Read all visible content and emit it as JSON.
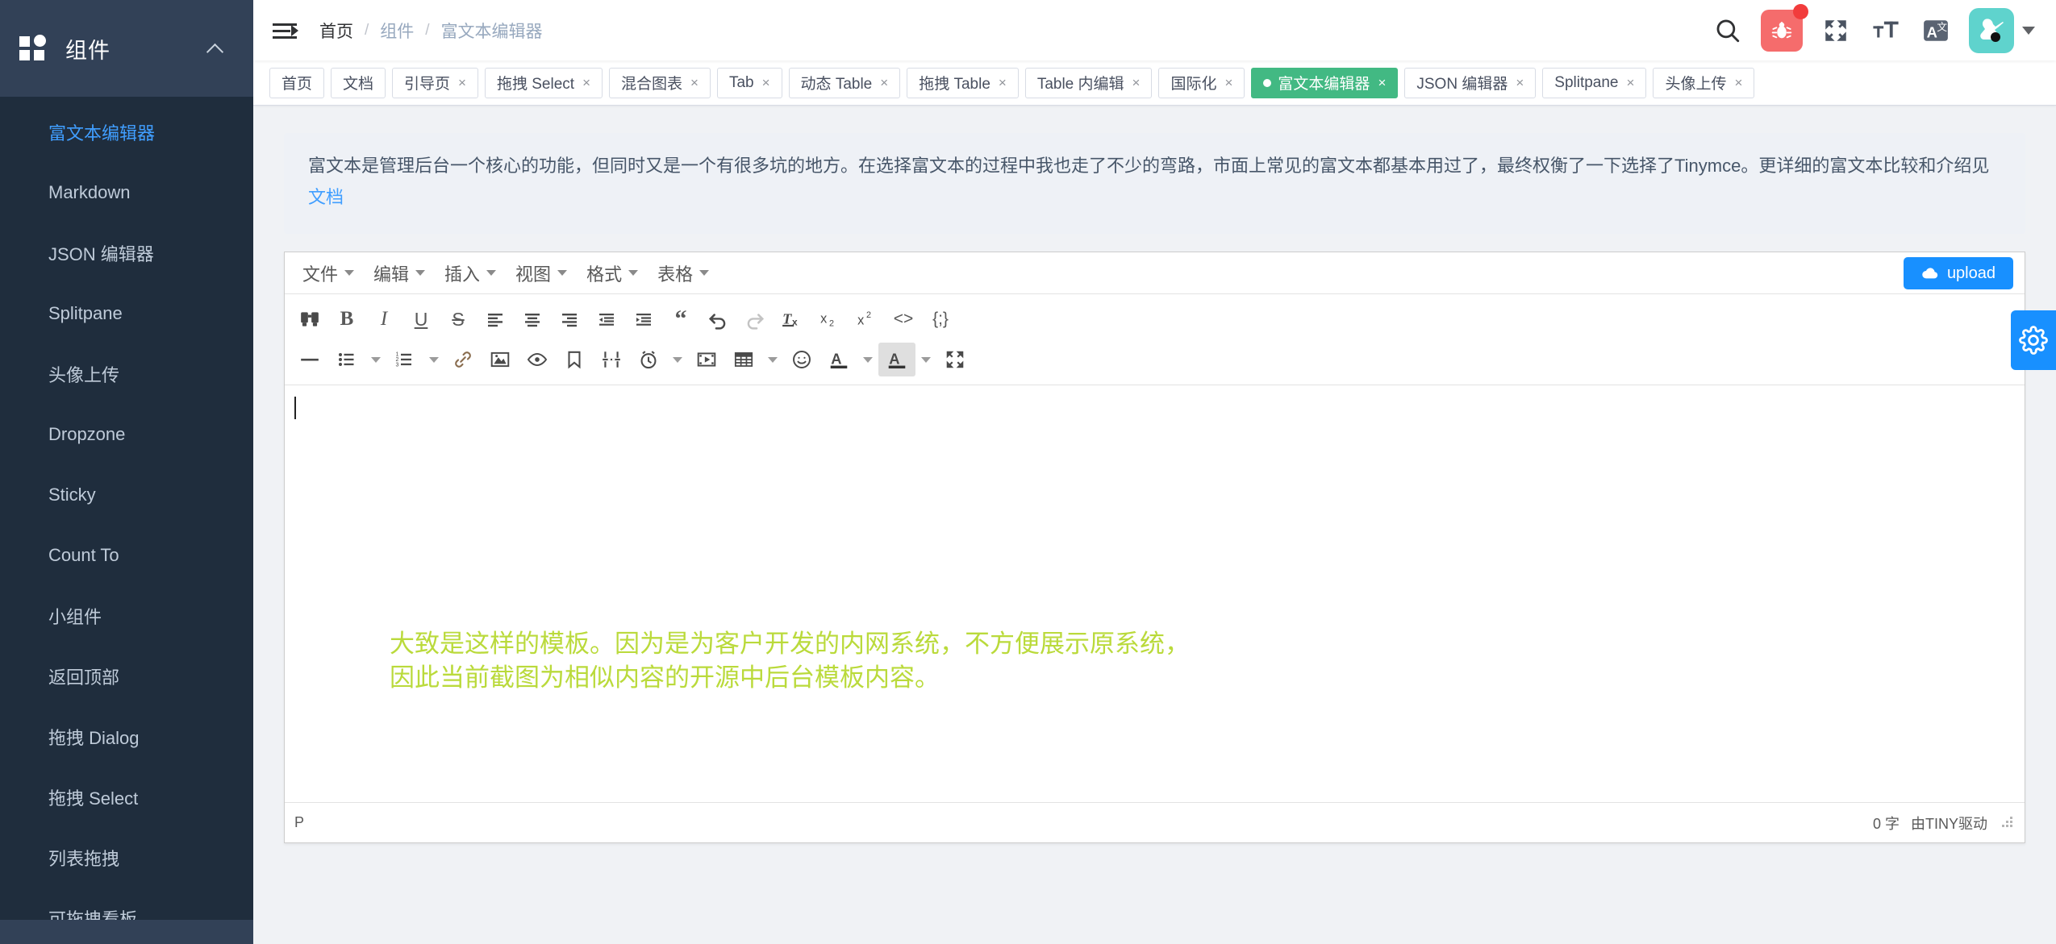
{
  "sidebar": {
    "brand": "组件",
    "logo_icon": "grid-icon",
    "collapse_icon": "chevron-up-icon",
    "items": [
      {
        "label": "富文本编辑器",
        "active": true
      },
      {
        "label": "Markdown",
        "active": false
      },
      {
        "label": "JSON 编辑器",
        "active": false
      },
      {
        "label": "Splitpane",
        "active": false
      },
      {
        "label": "头像上传",
        "active": false
      },
      {
        "label": "Dropzone",
        "active": false
      },
      {
        "label": "Sticky",
        "active": false
      },
      {
        "label": "Count To",
        "active": false
      },
      {
        "label": "小组件",
        "active": false
      },
      {
        "label": "返回顶部",
        "active": false
      },
      {
        "label": "拖拽 Dialog",
        "active": false
      },
      {
        "label": "拖拽 Select",
        "active": false
      },
      {
        "label": "列表拖拽",
        "active": false
      },
      {
        "label": "可拖拽看板",
        "active": false
      }
    ]
  },
  "navbar": {
    "hamburger_icon": "menu-fold-icon",
    "breadcrumb": [
      "首页",
      "组件",
      "富文本编辑器"
    ],
    "breadcrumb_separator": "/",
    "icons": [
      {
        "name": "search-icon",
        "glyph": "search"
      },
      {
        "name": "bug-icon",
        "glyph": "bug",
        "badge": true,
        "color": "#f56c6c"
      },
      {
        "name": "fullscreen-icon",
        "glyph": "expand"
      },
      {
        "name": "font-size-icon",
        "glyph": "tT"
      },
      {
        "name": "translate-icon",
        "glyph": "A文"
      }
    ],
    "avatar_color": "#5fd3cd",
    "avatar_icon": "user-avatar-image",
    "dropdown_icon": "caret-down-icon"
  },
  "tabs": [
    {
      "label": "首页",
      "closable": false,
      "active": false
    },
    {
      "label": "文档",
      "closable": false,
      "active": false
    },
    {
      "label": "引导页",
      "closable": true,
      "active": false
    },
    {
      "label": "拖拽 Select",
      "closable": true,
      "active": false
    },
    {
      "label": "混合图表",
      "closable": true,
      "active": false
    },
    {
      "label": "Tab",
      "closable": true,
      "active": false
    },
    {
      "label": "动态 Table",
      "closable": true,
      "active": false
    },
    {
      "label": "拖拽 Table",
      "closable": true,
      "active": false
    },
    {
      "label": "Table 内编辑",
      "closable": true,
      "active": false
    },
    {
      "label": "国际化",
      "closable": true,
      "active": false
    },
    {
      "label": "富文本编辑器",
      "closable": true,
      "active": true
    },
    {
      "label": "JSON 编辑器",
      "closable": true,
      "active": false
    },
    {
      "label": "Splitpane",
      "closable": true,
      "active": false
    },
    {
      "label": "头像上传",
      "closable": true,
      "active": false
    }
  ],
  "alert": {
    "text": "富文本是管理后台一个核心的功能，但同时又是一个有很多坑的地方。在选择富文本的过程中我也走了不少的弯路，市面上常见的富文本都基本用过了，最终权衡了一下选择了Tinymce。更详细的富文本比较和介绍见 ",
    "link": "文档"
  },
  "editor": {
    "menubar": [
      "文件",
      "编辑",
      "插入",
      "视图",
      "格式",
      "表格"
    ],
    "upload_label": "upload",
    "upload_icon": "cloud-upload-icon",
    "toolbar_row1": [
      {
        "name": "searchreplace-icon",
        "glyph": "⌕⌕"
      },
      {
        "name": "bold-icon",
        "glyph": "B"
      },
      {
        "name": "italic-icon",
        "glyph": "I"
      },
      {
        "name": "underline-icon",
        "glyph": "U"
      },
      {
        "name": "strikethrough-icon",
        "glyph": "S"
      },
      {
        "name": "align-left-icon",
        "glyph": "align-left"
      },
      {
        "name": "align-center-icon",
        "glyph": "align-center"
      },
      {
        "name": "align-right-icon",
        "glyph": "align-right"
      },
      {
        "name": "outdent-icon",
        "glyph": "outdent"
      },
      {
        "name": "indent-icon",
        "glyph": "indent"
      },
      {
        "name": "blockquote-icon",
        "glyph": "“"
      },
      {
        "name": "undo-icon",
        "glyph": "undo"
      },
      {
        "name": "redo-icon",
        "glyph": "redo"
      },
      {
        "name": "removeformat-icon",
        "glyph": "Tx"
      },
      {
        "name": "subscript-icon",
        "glyph": "x₂"
      },
      {
        "name": "superscript-icon",
        "glyph": "x²"
      },
      {
        "name": "code-icon",
        "glyph": "<>"
      },
      {
        "name": "codesample-icon",
        "glyph": "{;}"
      }
    ],
    "toolbar_row2": [
      {
        "name": "horizontal-rule-icon",
        "glyph": "—"
      },
      {
        "name": "bullist-icon",
        "glyph": "bullist",
        "dropdown": true
      },
      {
        "name": "numlist-icon",
        "glyph": "numlist",
        "dropdown": true
      },
      {
        "name": "link-icon",
        "glyph": "link"
      },
      {
        "name": "image-icon",
        "glyph": "image"
      },
      {
        "name": "preview-icon",
        "glyph": "eye"
      },
      {
        "name": "anchor-icon",
        "glyph": "bookmark"
      },
      {
        "name": "pagebreak-icon",
        "glyph": "pagebreak"
      },
      {
        "name": "insertdatetime-icon",
        "glyph": "clock",
        "dropdown": true
      },
      {
        "name": "media-icon",
        "glyph": "film"
      },
      {
        "name": "table-icon",
        "glyph": "table",
        "dropdown": true
      },
      {
        "name": "emoticons-icon",
        "glyph": "☺"
      },
      {
        "name": "forecolor-icon",
        "glyph": "A",
        "dropdown": true
      },
      {
        "name": "backcolor-icon",
        "glyph": "A",
        "dropdown": true,
        "selected": true
      },
      {
        "name": "fullscreen-icon",
        "glyph": "expand"
      }
    ],
    "content_text": "大致是这样的模板。因为是为客户开发的内网系统，不方便展示原系统，\n因此当前截图为相似内容的开源中后台模板内容。",
    "content_color": "#bada3b",
    "status_path": "P",
    "status_words": "0 字",
    "status_brand": "由TINY驱动"
  },
  "settings_panel": {
    "icon": "gear-icon",
    "color": "#1890ff"
  }
}
